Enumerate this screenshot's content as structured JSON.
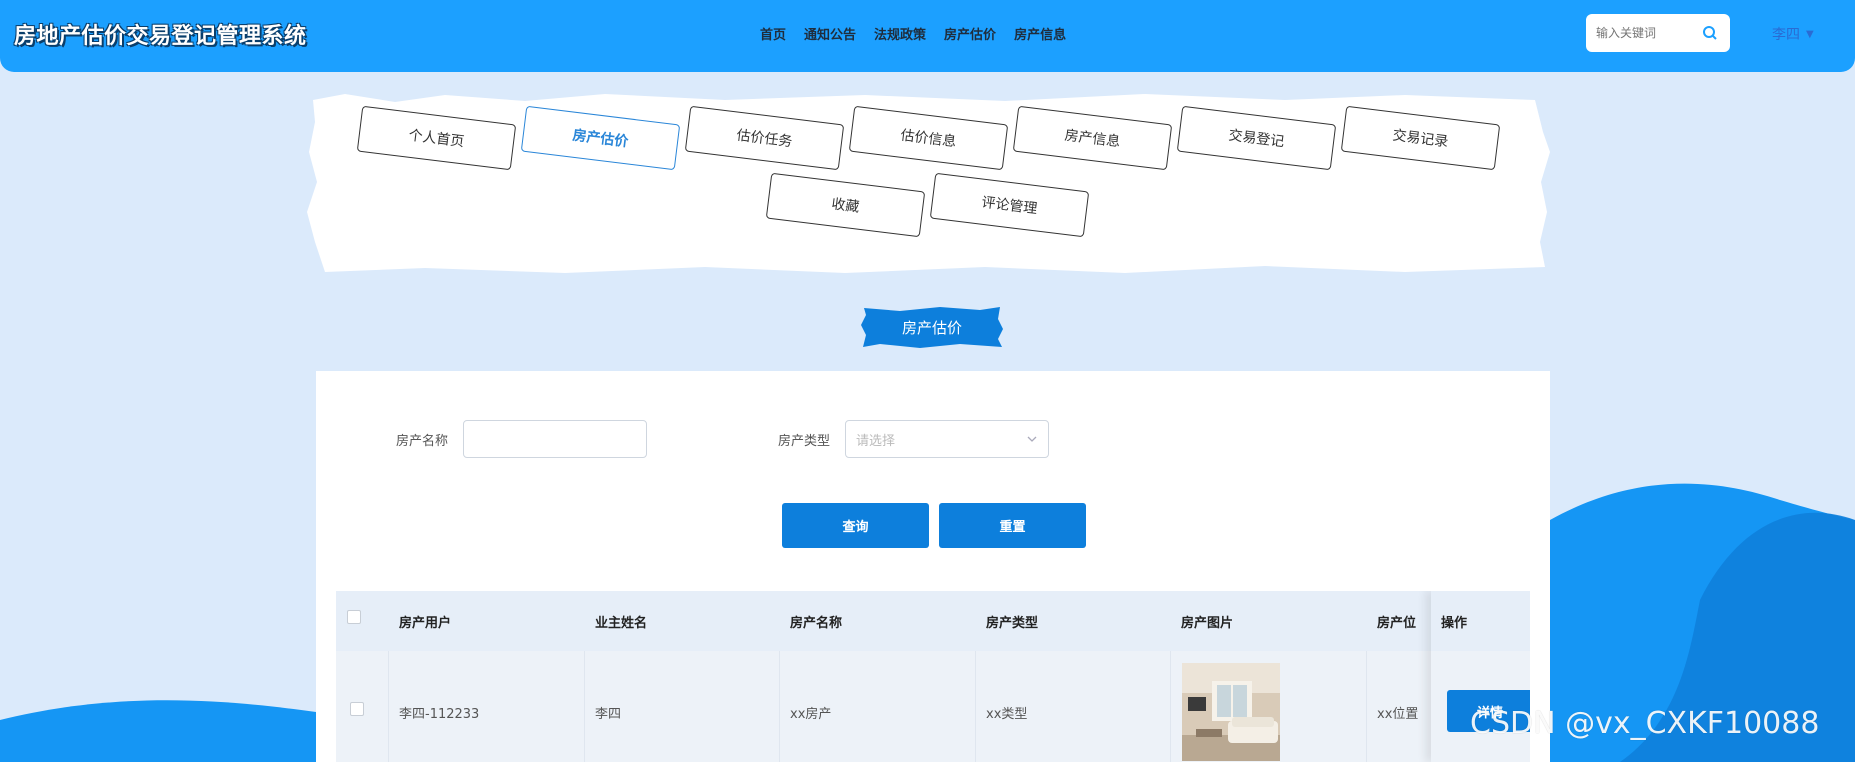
{
  "colors": {
    "header": "#1ca0ff",
    "primary": "#0d7fdc",
    "page_bg": "#dbeafb",
    "active": "#2a86d8"
  },
  "header": {
    "site_title": "房地产估价交易登记管理系统",
    "nav": [
      "首页",
      "通知公告",
      "法规政策",
      "房产估价",
      "房产信息"
    ],
    "search_placeholder": "输入关键词",
    "user_name": "李四"
  },
  "categories": {
    "row1": [
      "个人首页",
      "房产估价",
      "估价任务",
      "估价信息",
      "房产信息",
      "交易登记",
      "交易记录"
    ],
    "row2": [
      "收藏",
      "评论管理"
    ],
    "active": "房产估价"
  },
  "section_title": "房产估价",
  "search_form": {
    "name_label": "房产名称",
    "name_value": "",
    "type_label": "房产类型",
    "type_placeholder": "请选择",
    "query_button": "查询",
    "reset_button": "重置"
  },
  "table": {
    "headers": [
      "房产用户",
      "业主姓名",
      "房产名称",
      "房产类型",
      "房产图片",
      "房产位"
    ],
    "ops_header": "操作",
    "rows": [
      {
        "user": "李四-112233",
        "owner": "李四",
        "name": "xx房产",
        "type": "xx类型",
        "image_icon": "house-photo",
        "location": "xx位置",
        "action": "详情"
      }
    ]
  },
  "watermark": "CSDN @vx_CXKF10088"
}
